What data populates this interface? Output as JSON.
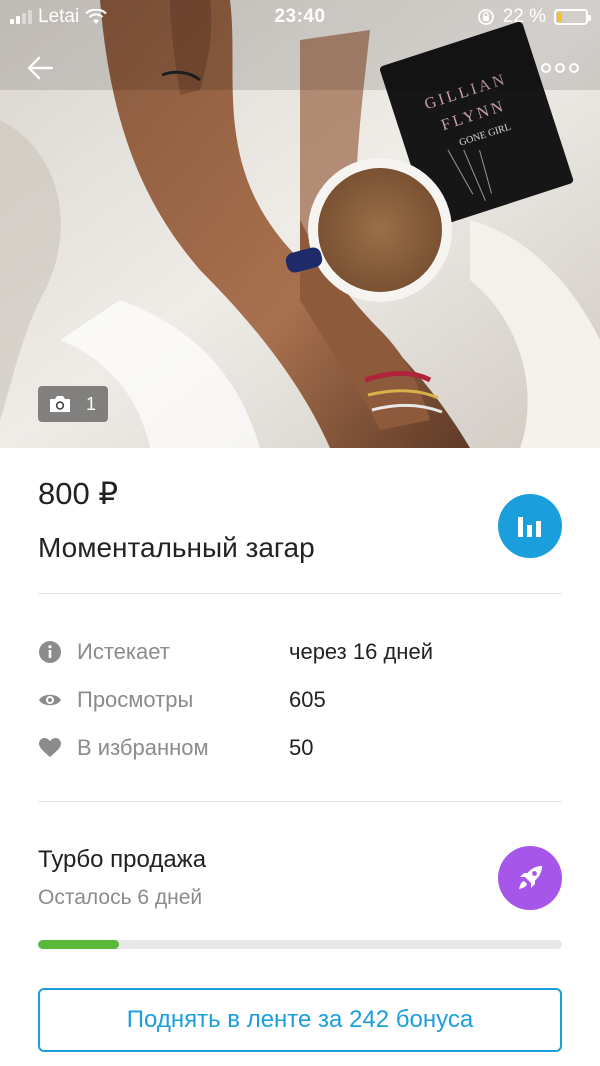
{
  "status_bar": {
    "carrier": "Letai",
    "time": "23:40",
    "battery_percent": "22 %",
    "battery_level": 0.22,
    "battery_color": "#f4c430",
    "signal_bars_active": 2
  },
  "header": {
    "back_icon": "arrow-left-icon",
    "more_icon": "more-horizontal-icon",
    "photo_count": "1",
    "photo_icon": "camera-icon"
  },
  "listing": {
    "price": "800 ₽",
    "title": "Моментальный загар",
    "stats_icon": "bar-chart-icon"
  },
  "info": [
    {
      "icon": "info-icon",
      "label": "Истекает",
      "value": "через 16 дней"
    },
    {
      "icon": "eye-icon",
      "label": "Просмотры",
      "value": "605"
    },
    {
      "icon": "heart-icon",
      "label": "В избранном",
      "value": "50"
    }
  ],
  "turbo": {
    "title": "Турбо продажа",
    "remaining": "Осталось 6 дней",
    "progress": 0.155,
    "icon": "rocket-icon"
  },
  "cta": {
    "label": "Поднять в ленте за 242 бонуса"
  },
  "colors": {
    "accent_blue": "#1b9fdc",
    "accent_purple": "#a656e8",
    "progress_green": "#5ab93b",
    "secondary_text": "#8b8b8b"
  }
}
